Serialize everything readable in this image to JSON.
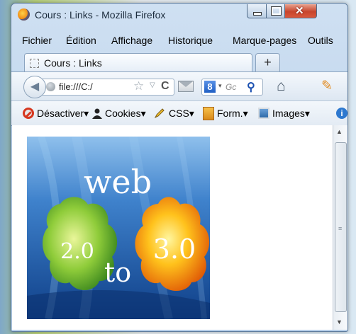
{
  "window": {
    "title": "Cours : Links - Mozilla Firefox"
  },
  "menu": {
    "items": [
      "Fichier",
      "Édition",
      "Affichage",
      "Historique",
      "Marque-pages",
      "Outils"
    ]
  },
  "tabs": {
    "active_label": "Cours : Links",
    "new_tab_glyph": "+"
  },
  "nav": {
    "url": "file:///C:/",
    "search_engine_badge": "8",
    "search_placeholder": "Gc"
  },
  "devbar": {
    "items": [
      "Désactiver",
      "Cookies",
      "CSS",
      "Form.",
      "Images"
    ]
  },
  "image": {
    "line1": "web",
    "left_blob": "2.0",
    "middle": "to",
    "right_blob": "3.0"
  },
  "colors": {
    "accent": "#2d78cf",
    "image_bg_top": "#7db4e6",
    "image_bg_bottom": "#0f3f88",
    "green_blob": "#7ec734",
    "orange_blob": "#f59a16"
  },
  "icons": [
    "firefox-logo",
    "back-arrow",
    "globe",
    "star",
    "reload",
    "mail",
    "search",
    "home",
    "addon-puzzle",
    "disable-icon",
    "cookie-icon",
    "css-pencil-icon",
    "form-icon",
    "image-icon",
    "info-icon"
  ]
}
